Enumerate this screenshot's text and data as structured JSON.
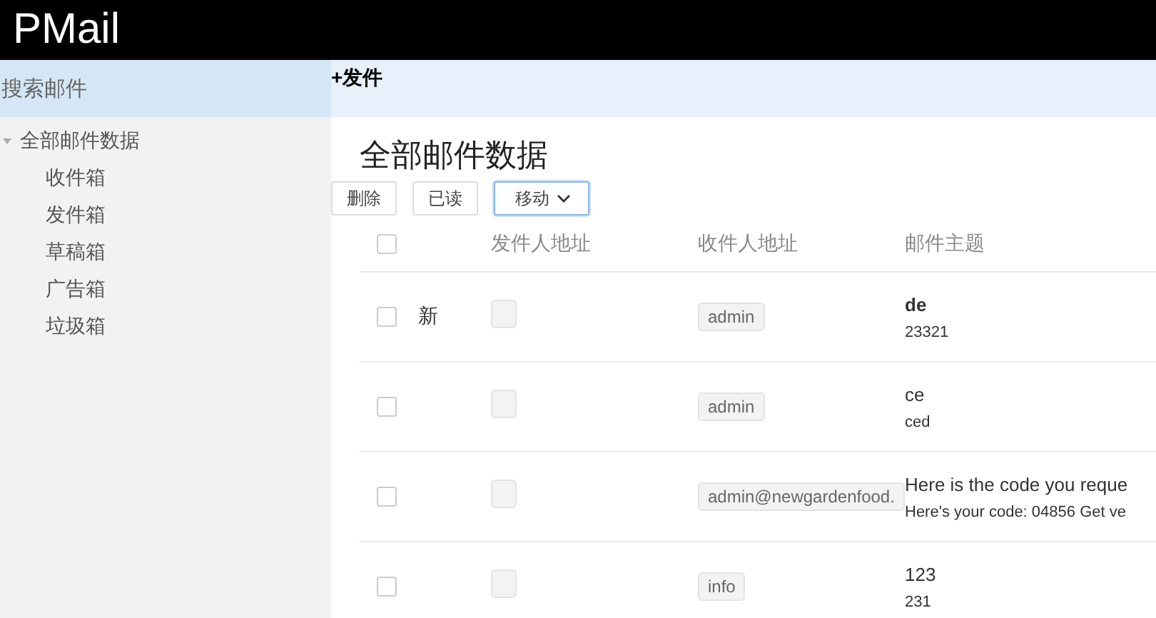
{
  "header": {
    "logo": "PMail"
  },
  "sidebar": {
    "search": {
      "placeholder": "搜索邮件"
    },
    "tree": [
      {
        "label": "全部邮件数据",
        "expanded": true,
        "children": [
          {
            "label": "收件箱"
          },
          {
            "label": "发件箱"
          },
          {
            "label": "草稿箱"
          },
          {
            "label": "广告箱"
          },
          {
            "label": "垃圾箱"
          }
        ]
      }
    ]
  },
  "topbar": {
    "compose": "+发件"
  },
  "title": "全部邮件数据",
  "toolbar": [
    {
      "label": "删除",
      "kind": "plain",
      "focused": false
    },
    {
      "label": "已读",
      "kind": "plain",
      "focused": false
    },
    {
      "label": "移动",
      "kind": "dropdown",
      "focused": true
    }
  ],
  "table": {
    "select_all_checked": false,
    "columns": [
      "发件人地址",
      "收件人地址",
      "邮件主题"
    ],
    "rows": [
      {
        "checked": false,
        "unread": true,
        "flag": "新",
        "recipient": "admin",
        "subject": "de",
        "snippet": "23321"
      },
      {
        "checked": false,
        "unread": false,
        "recipient": "admin",
        "subject": "ce",
        "snippet": "ced"
      },
      {
        "checked": false,
        "unread": false,
        "recipient": "admin@newgardenfood.",
        "subject": "Here is the code you reque",
        "snippet": "Here's your code: 04856 Get ve"
      },
      {
        "checked": false,
        "unread": false,
        "recipient": "info",
        "subject": "123",
        "snippet": "231"
      }
    ]
  }
}
